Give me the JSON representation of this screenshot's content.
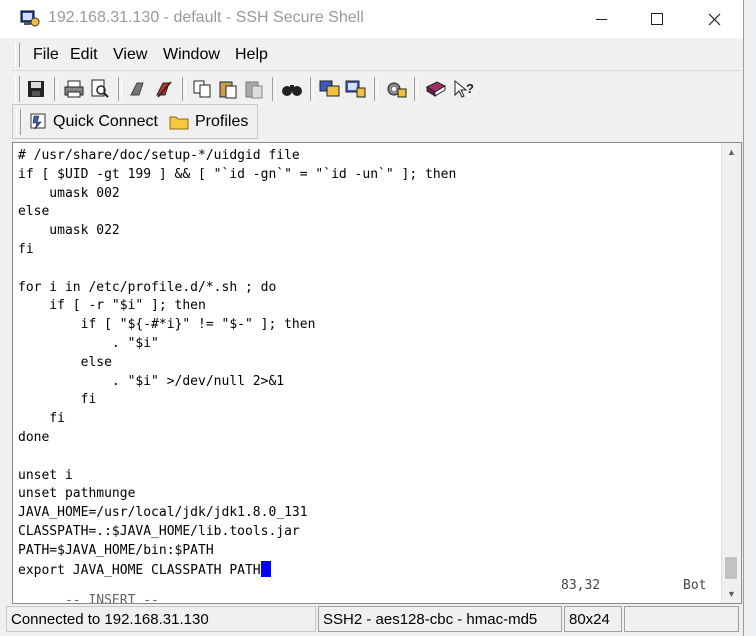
{
  "window": {
    "title": "192.168.31.130 - default - SSH Secure Shell",
    "minimize_glyph": "—",
    "maximize_glyph": "☐",
    "close_glyph": "✕"
  },
  "menu": [
    {
      "label": "File"
    },
    {
      "label": "Edit"
    },
    {
      "label": "View"
    },
    {
      "label": "Window"
    },
    {
      "label": "Help"
    }
  ],
  "toolbar": {
    "icons": [
      "save-icon",
      "print-icon",
      "print-preview-icon",
      "disconnect-icon",
      "connect-icon",
      "copy-icon",
      "paste-icon",
      "paste-disabled-icon",
      "find-icon",
      "file-transfer-icon",
      "new-terminal-icon",
      "settings-icon",
      "help-book-icon",
      "context-help-icon"
    ]
  },
  "quickbar": {
    "quick_connect": "Quick Connect",
    "profiles": "Profiles"
  },
  "terminal": {
    "lines": [
      "# /usr/share/doc/setup-*/uidgid file",
      "if [ $UID -gt 199 ] && [ \"`id -gn`\" = \"`id -un`\" ]; then",
      "    umask 002",
      "else",
      "    umask 022",
      "fi",
      "",
      "for i in /etc/profile.d/*.sh ; do",
      "    if [ -r \"$i\" ]; then",
      "        if [ \"${-#*i}\" != \"$-\" ]; then",
      "            . \"$i\"",
      "        else",
      "            . \"$i\" >/dev/null 2>&1",
      "        fi",
      "    fi",
      "done",
      "",
      "unset i",
      "unset pathmunge",
      "JAVA_HOME=/usr/local/jdk/jdk1.8.0_131",
      "CLASSPATH=.:$JAVA_HOME/lib.tools.jar",
      "PATH=$JAVA_HOME/bin:$PATH",
      "export JAVA_HOME CLASSPATH PATH"
    ],
    "mode": "-- INSERT --",
    "position": "83,32",
    "scroll_position": "Bot"
  },
  "statusbar": {
    "connection": "Connected to 192.168.31.130",
    "protocol": "SSH2 - aes128-cbc - hmac-md5",
    "size": "80x24"
  },
  "colors": {
    "cursor": "#0000ff",
    "title_text": "#999999"
  }
}
